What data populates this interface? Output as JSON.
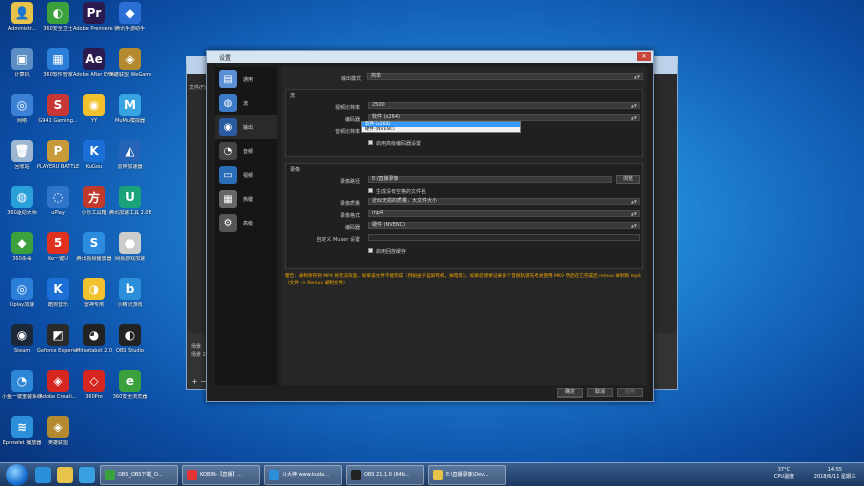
{
  "desktop_icons": [
    {
      "label": "Administr...",
      "color": "#e8c34a",
      "glyph": "👤"
    },
    {
      "label": "360安全卫士",
      "color": "#3aa13d",
      "glyph": "◐"
    },
    {
      "label": "Adobe Premiere P...",
      "color": "#2a1a4d",
      "glyph": "Pr"
    },
    {
      "label": "腾讯手游助手",
      "color": "#2a6fd6",
      "glyph": "◆"
    },
    {
      "label": "计算机",
      "color": "#5b8ec4",
      "glyph": "▣"
    },
    {
      "label": "360软件管家",
      "color": "#2b7fd8",
      "glyph": "▦"
    },
    {
      "label": "Adobe After Effects CC...",
      "color": "#2a1a4d",
      "glyph": "Ae"
    },
    {
      "label": "英雄联盟 WeGame版",
      "color": "#b38a2f",
      "glyph": "◈"
    },
    {
      "label": "网络",
      "color": "#3b82d6",
      "glyph": "◎"
    },
    {
      "label": "G941 Gaming...",
      "color": "#c93636",
      "glyph": "S"
    },
    {
      "label": "YY",
      "color": "#f2c12e",
      "glyph": "◉"
    },
    {
      "label": "MuMu模拟器",
      "color": "#37a3e0",
      "glyph": "M"
    },
    {
      "label": "回收站",
      "color": "#9db6d2",
      "glyph": "🗑"
    },
    {
      "label": "PLAYERU BATTLEG...",
      "color": "#c89a3a",
      "glyph": "P"
    },
    {
      "label": "KuGou",
      "color": "#1d6fd8",
      "glyph": "K"
    },
    {
      "label": "雷神加速器",
      "color": "#2563b7",
      "glyph": "◭"
    },
    {
      "label": "360驱动大师",
      "color": "#2aa0d8",
      "glyph": "◍"
    },
    {
      "label": "uPlay",
      "color": "#2f74c9",
      "glyph": "◌"
    },
    {
      "label": "小乐工具箱",
      "color": "#c0392b",
      "glyph": "方"
    },
    {
      "label": "腾讯加速工具 2.0Beta",
      "color": "#1aa37a",
      "glyph": "U"
    },
    {
      "label": "360杀毒",
      "color": "#3aa13d",
      "glyph": "◆"
    },
    {
      "label": "Ke一键U",
      "color": "#e0301e",
      "glyph": "5"
    },
    {
      "label": "腾讯视频播放器",
      "color": "#2c8de0",
      "glyph": "S"
    },
    {
      "label": "网易游戏加速",
      "color": "#cccccc",
      "glyph": "●"
    },
    {
      "label": "Uplay加速",
      "color": "#2b7fd8",
      "glyph": "◎"
    },
    {
      "label": "酷狗音乐",
      "color": "#1d6fd8",
      "glyph": "K"
    },
    {
      "label": "雷神专用",
      "color": "#f2c12e",
      "glyph": "◑"
    },
    {
      "label": "小精灵游戏",
      "color": "#2b90d9",
      "glyph": "b"
    },
    {
      "label": "Steam",
      "color": "#1b2838",
      "glyph": "◉"
    },
    {
      "label": "Geforce Experience",
      "color": "#2a2a2a",
      "glyph": "◩"
    },
    {
      "label": "Mitsetabot 2.0",
      "color": "#222",
      "glyph": "◕"
    },
    {
      "label": "OBS Studio",
      "color": "#222",
      "glyph": "◐"
    },
    {
      "label": "小鱼一键重装系统",
      "color": "#2e86d6",
      "glyph": "◔"
    },
    {
      "label": "Adobe Creati...",
      "color": "#d6261f",
      "glyph": "◈"
    },
    {
      "label": "360Pro",
      "color": "#d6261f",
      "glyph": "◇"
    },
    {
      "label": "360安全浏览器",
      "color": "#3aa13d",
      "glyph": "e"
    },
    {
      "label": "Eprowlet 播放器",
      "color": "#2b90d9",
      "glyph": "≋"
    },
    {
      "label": "英雄联盟",
      "color": "#b38a2f",
      "glyph": "◈"
    }
  ],
  "settings_window": {
    "title": "设置",
    "sidebar": [
      {
        "label": "通用",
        "icon": "general-icon",
        "color": "#5a8fd6",
        "glyph": "▤"
      },
      {
        "label": "流",
        "icon": "stream-icon",
        "color": "#3b7ac8",
        "glyph": "◍"
      },
      {
        "label": "输出",
        "icon": "output-icon",
        "color": "#2a5aa0",
        "glyph": "◉"
      },
      {
        "label": "音频",
        "icon": "audio-icon",
        "color": "#444",
        "glyph": "◔"
      },
      {
        "label": "视频",
        "icon": "video-icon",
        "color": "#2b6cb8",
        "glyph": "▭"
      },
      {
        "label": "热键",
        "icon": "hotkey-icon",
        "color": "#666",
        "glyph": "▦"
      },
      {
        "label": "高级",
        "icon": "advanced-icon",
        "color": "#555",
        "glyph": "⚙"
      }
    ],
    "output_mode_label": "输出模式",
    "output_mode_value": "简单",
    "stream_section": "流",
    "video_bitrate_label": "视频比特率",
    "video_bitrate_value": "2500",
    "encoder_label": "编码器",
    "encoder_value": "软件 (x264)",
    "audio_bitrate_label": "音频比特率",
    "dropdown_options": [
      "软件 (x264)",
      "硬件 (NVENC)"
    ],
    "advanced_encoder_label": "启用高级编码器设置",
    "recording_section": "录像",
    "record_path_label": "录像路径",
    "record_path_value": "E:/直播录像",
    "browse_label": "浏览",
    "no_space_label": "生成没有空格的文件名",
    "record_quality_label": "录像质量",
    "record_quality_value": "近似无损的质量，大文件大小",
    "record_format_label": "录像格式",
    "record_format_value": "mp4",
    "rec_encoder_label": "编码器",
    "rec_encoder_value": "硬件 (NVENC)",
    "muxer_label": "自定义 Muxer 设置",
    "replay_buffer_label": "启用回放缓存",
    "warning_text": "警告：录制保存到 MP4 将无法恢复，如果该文件不能完成（例如由于蓝屏死机，掉电等）。如果您想要记录多个音频轨道先考虑使用 MKV 然后在它完成后 remux 录制到 mp4（文件 -> Remux 录制文件）",
    "ok_label": "确定",
    "cancel_label": "取消",
    "apply_label": "应用"
  },
  "obs_back": {
    "side_label": "文件(F)",
    "scene_label1": "场景",
    "scene_label2": "场景 2"
  },
  "taskbar": {
    "tasks": [
      {
        "label": "OBS_OBS下载_O...",
        "color": "#3aa13d"
      },
      {
        "label": "KOBIN-【直播】...",
        "color": "#e63333"
      },
      {
        "label": "斗大神 www.kuda...",
        "color": "#2b90d9"
      },
      {
        "label": "OBS 21.1.0 (64b...",
        "color": "#222"
      },
      {
        "label": "E:\\直播录像\\Dev...",
        "color": "#e8c34a"
      }
    ],
    "temperature": "37°C",
    "temp_label": "CPU温度",
    "time": "14:55",
    "date": "2018/6/11 星期三"
  }
}
